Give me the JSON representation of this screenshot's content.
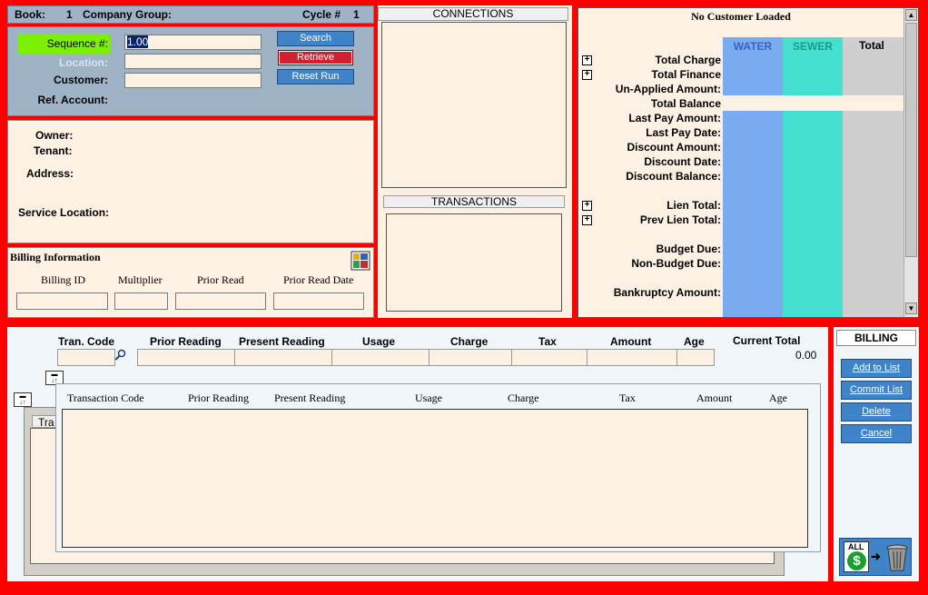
{
  "header": {
    "book_label": "Book:",
    "book_value": "1",
    "company_group_label": "Company Group:",
    "cycle_label": "Cycle #",
    "cycle_value": "1"
  },
  "search": {
    "sequence_label": "Sequence #:",
    "sequence_value": "1.00",
    "location_label": "Location:",
    "customer_label": "Customer:",
    "ref_account_label": "Ref. Account:",
    "search_button": "Search",
    "retrieve_button": "Retrieve",
    "reset_button": "Reset Run"
  },
  "owner": {
    "owner_label": "Owner:",
    "tenant_label": "Tenant:",
    "address_label": "Address:",
    "service_location_label": "Service Location:"
  },
  "billing_info": {
    "title": "Billing Information",
    "columns": [
      "Billing ID",
      "Multiplier",
      "Prior Read",
      "Prior Read Date"
    ]
  },
  "connections": {
    "title": "CONNECTIONS",
    "transactions_title": "TRANSACTIONS"
  },
  "account": {
    "title": "No Customer Loaded",
    "col_water": "WATER",
    "col_sewer": "SEWER",
    "col_total": "Total",
    "rows": [
      "Total Charge",
      "Total Finance",
      "Un-Applied Amount:",
      "Total Balance",
      "Last Pay Amount:",
      "Last Pay Date:",
      "Discount Amount:",
      "Discount Date:",
      "Discount Balance:",
      "Lien Total:",
      "Prev Lien Total:",
      "Budget Due:",
      "Non-Budget Due:",
      "Bankruptcy Amount:"
    ],
    "colors": {
      "water": "#7aaaf0",
      "sewer": "#45e0d0",
      "total": "#cfcfcf"
    }
  },
  "entry": {
    "headers": [
      "Tran. Code",
      "Prior Reading",
      "Present Reading",
      "Usage",
      "Charge",
      "Tax",
      "Amount",
      "Age"
    ],
    "current_total_label": "Current Total",
    "current_total_value": "0.00"
  },
  "grid": {
    "headers": [
      "Transaction Code",
      "Prior Reading",
      "Present Reading",
      "Usage",
      "Charge",
      "Tax",
      "Amount",
      "Age"
    ],
    "behind_label": "Tra"
  },
  "side": {
    "title": "BILLING",
    "buttons": [
      "Add to List",
      "Commit List",
      "Delete",
      "Cancel"
    ],
    "all_label": "ALL"
  }
}
